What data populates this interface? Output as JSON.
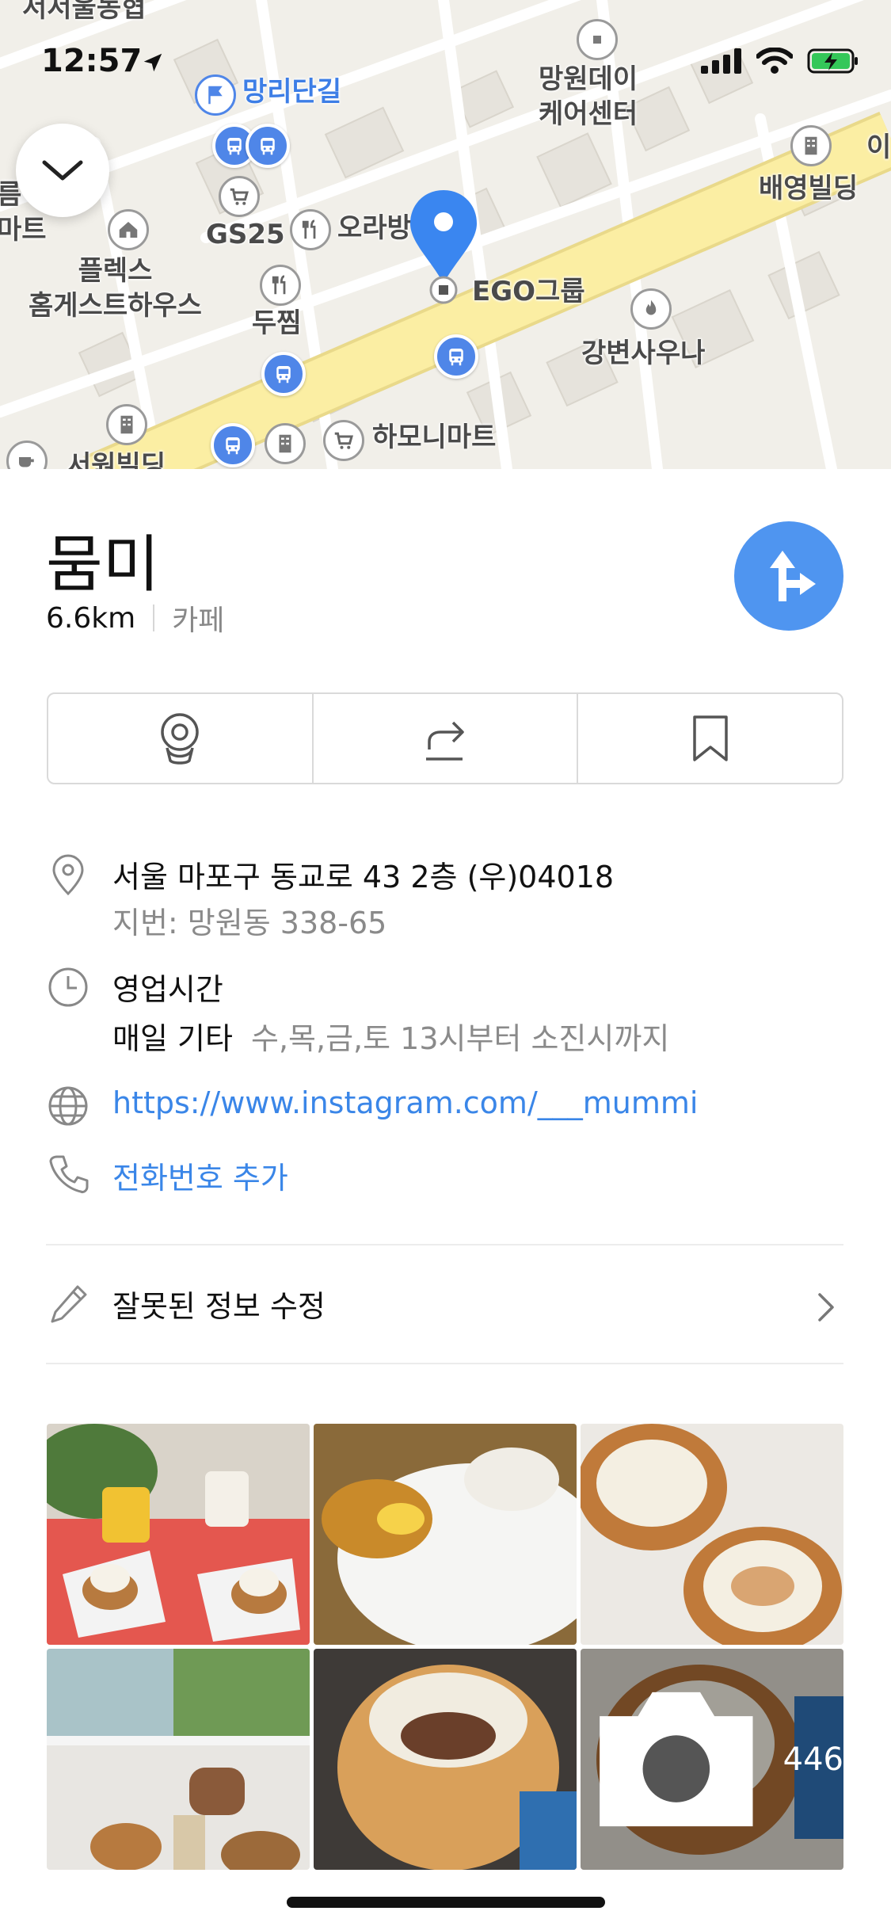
{
  "status_bar": {
    "time": "12:57"
  },
  "map": {
    "labels": {
      "mangri": "망리단길",
      "mangwon_daycare": "망원데이\n케어센터",
      "baeyoung": "배영빌딩",
      "gs25": "GS25",
      "orabang": "오라방",
      "ego": "EGO그룹",
      "flex": "플렉스\n홈게스트하우스",
      "dujjim": "두찜",
      "gangbyeon": "강변사우나",
      "hamoni": "하모니마트",
      "seowon": "서원빌딩",
      "top_left": "서서울농협",
      "left_edge": "름\n마트",
      "right_edge": "이"
    },
    "colors": {
      "road_main": "#fbeea3",
      "road": "#ffffff",
      "ground": "#f1efe9",
      "building": "#e6e3dc",
      "pin": "#3a86f0",
      "bus": "#4f86e8"
    }
  },
  "place": {
    "name": "뭄미",
    "distance": "6.6km",
    "category": "카페"
  },
  "actions": [
    {
      "icon": "street-view-icon"
    },
    {
      "icon": "share-icon"
    },
    {
      "icon": "bookmark-icon"
    }
  ],
  "info": {
    "address": "서울 마포구 동교로 43 2층 (우)04018",
    "jibun": "지번: 망원동 338-65",
    "hours_title": "영업시간",
    "hours_day": "매일 기타",
    "hours_detail": "수,목,금,토 13시부터 소진시까지",
    "website": "https://www.instagram.com/___mummi",
    "phone_add": "전화번호 추가"
  },
  "edit": {
    "label": "잘못된 정보 수정"
  },
  "photos": {
    "count": "446"
  },
  "colors": {
    "accent": "#3a86e8",
    "directions": "#4f95f0"
  }
}
